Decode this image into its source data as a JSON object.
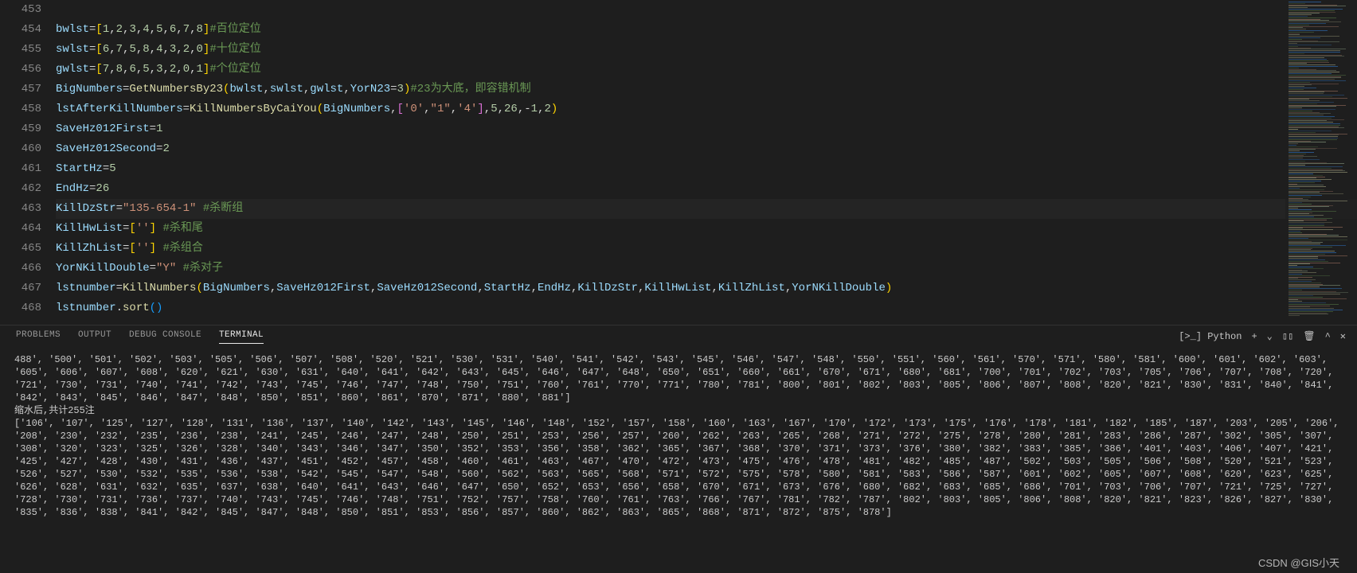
{
  "editor": {
    "lines": [
      {
        "num": 453,
        "tokens": []
      },
      {
        "num": 454,
        "tokens": [
          [
            "v",
            "bwlst"
          ],
          [
            "op",
            "="
          ],
          [
            "p",
            "["
          ],
          [
            "n",
            "1"
          ],
          [
            "op",
            ","
          ],
          [
            "n",
            "2"
          ],
          [
            "op",
            ","
          ],
          [
            "n",
            "3"
          ],
          [
            "op",
            ","
          ],
          [
            "n",
            "4"
          ],
          [
            "op",
            ","
          ],
          [
            "n",
            "5"
          ],
          [
            "op",
            ","
          ],
          [
            "n",
            "6"
          ],
          [
            "op",
            ","
          ],
          [
            "n",
            "7"
          ],
          [
            "op",
            ","
          ],
          [
            "n",
            "8"
          ],
          [
            "p",
            "]"
          ],
          [
            "c",
            "#百位定位"
          ]
        ]
      },
      {
        "num": 455,
        "tokens": [
          [
            "v",
            "swlst"
          ],
          [
            "op",
            "="
          ],
          [
            "p",
            "["
          ],
          [
            "n",
            "6"
          ],
          [
            "op",
            ","
          ],
          [
            "n",
            "7"
          ],
          [
            "op",
            ","
          ],
          [
            "n",
            "5"
          ],
          [
            "op",
            ","
          ],
          [
            "n",
            "8"
          ],
          [
            "op",
            ","
          ],
          [
            "n",
            "4"
          ],
          [
            "op",
            ","
          ],
          [
            "n",
            "3"
          ],
          [
            "op",
            ","
          ],
          [
            "n",
            "2"
          ],
          [
            "op",
            ","
          ],
          [
            "n",
            "0"
          ],
          [
            "p",
            "]"
          ],
          [
            "c",
            "#十位定位"
          ]
        ]
      },
      {
        "num": 456,
        "tokens": [
          [
            "v",
            "gwlst"
          ],
          [
            "op",
            "="
          ],
          [
            "p",
            "["
          ],
          [
            "n",
            "7"
          ],
          [
            "op",
            ","
          ],
          [
            "n",
            "8"
          ],
          [
            "op",
            ","
          ],
          [
            "n",
            "6"
          ],
          [
            "op",
            ","
          ],
          [
            "n",
            "5"
          ],
          [
            "op",
            ","
          ],
          [
            "n",
            "3"
          ],
          [
            "op",
            ","
          ],
          [
            "n",
            "2"
          ],
          [
            "op",
            ","
          ],
          [
            "n",
            "0"
          ],
          [
            "op",
            ","
          ],
          [
            "n",
            "1"
          ],
          [
            "p",
            "]"
          ],
          [
            "c",
            "#个位定位"
          ]
        ]
      },
      {
        "num": 457,
        "tokens": [
          [
            "v",
            "BigNumbers"
          ],
          [
            "op",
            "="
          ],
          [
            "f",
            "GetNumbersBy23"
          ],
          [
            "p",
            "("
          ],
          [
            "v",
            "bwlst"
          ],
          [
            "op",
            ","
          ],
          [
            "v",
            "swlst"
          ],
          [
            "op",
            ","
          ],
          [
            "v",
            "gwlst"
          ],
          [
            "op",
            ","
          ],
          [
            "v",
            "YorN23"
          ],
          [
            "op",
            "="
          ],
          [
            "n",
            "3"
          ],
          [
            "p",
            ")"
          ],
          [
            "c",
            "#23为大底，即容错机制"
          ]
        ]
      },
      {
        "num": 458,
        "tokens": [
          [
            "v",
            "lstAfterKillNumbers"
          ],
          [
            "op",
            "="
          ],
          [
            "f",
            "KillNumbersByCaiYou"
          ],
          [
            "p",
            "("
          ],
          [
            "v",
            "BigNumbers"
          ],
          [
            "op",
            ","
          ],
          [
            "p2",
            "["
          ],
          [
            "s",
            "'0'"
          ],
          [
            "op",
            ","
          ],
          [
            "s",
            "\"1\""
          ],
          [
            "op",
            ","
          ],
          [
            "s",
            "'4'"
          ],
          [
            "p2",
            "]"
          ],
          [
            "op",
            ","
          ],
          [
            "n",
            "5"
          ],
          [
            "op",
            ","
          ],
          [
            "n",
            "26"
          ],
          [
            "op",
            ",-"
          ],
          [
            "n",
            "1"
          ],
          [
            "op",
            ","
          ],
          [
            "n",
            "2"
          ],
          [
            "p",
            ")"
          ]
        ]
      },
      {
        "num": 459,
        "tokens": [
          [
            "v",
            "SaveHz012First"
          ],
          [
            "op",
            "="
          ],
          [
            "n",
            "1"
          ]
        ]
      },
      {
        "num": 460,
        "tokens": [
          [
            "v",
            "SaveHz012Second"
          ],
          [
            "op",
            "="
          ],
          [
            "n",
            "2"
          ]
        ]
      },
      {
        "num": 461,
        "tokens": [
          [
            "v",
            "StartHz"
          ],
          [
            "op",
            "="
          ],
          [
            "n",
            "5"
          ]
        ]
      },
      {
        "num": 462,
        "tokens": [
          [
            "v",
            "EndHz"
          ],
          [
            "op",
            "="
          ],
          [
            "n",
            "26"
          ]
        ]
      },
      {
        "num": 463,
        "hl": true,
        "tokens": [
          [
            "v",
            "KillDzStr"
          ],
          [
            "op",
            "="
          ],
          [
            "s",
            "\"135-654-1\""
          ],
          [
            "op",
            " "
          ],
          [
            "c",
            "#杀断组"
          ]
        ]
      },
      {
        "num": 464,
        "tokens": [
          [
            "v",
            "KillHwList"
          ],
          [
            "op",
            "="
          ],
          [
            "p",
            "["
          ],
          [
            "s",
            "''"
          ],
          [
            "p",
            "]"
          ],
          [
            "op",
            " "
          ],
          [
            "c",
            "#杀和尾"
          ]
        ]
      },
      {
        "num": 465,
        "tokens": [
          [
            "v",
            "KillZhList"
          ],
          [
            "op",
            "="
          ],
          [
            "p",
            "["
          ],
          [
            "s",
            "''"
          ],
          [
            "p",
            "]"
          ],
          [
            "op",
            " "
          ],
          [
            "c",
            "#杀组合"
          ]
        ]
      },
      {
        "num": 466,
        "tokens": [
          [
            "v",
            "YorNKillDouble"
          ],
          [
            "op",
            "="
          ],
          [
            "s",
            "\"Y\""
          ],
          [
            "op",
            " "
          ],
          [
            "c",
            "#杀对子"
          ]
        ]
      },
      {
        "num": 467,
        "tokens": [
          [
            "v",
            "lstnumber"
          ],
          [
            "op",
            "="
          ],
          [
            "f",
            "KillNumbers"
          ],
          [
            "p",
            "("
          ],
          [
            "v",
            "BigNumbers"
          ],
          [
            "op",
            ","
          ],
          [
            "v",
            "SaveHz012First"
          ],
          [
            "op",
            ","
          ],
          [
            "v",
            "SaveHz012Second"
          ],
          [
            "op",
            ","
          ],
          [
            "v",
            "StartHz"
          ],
          [
            "op",
            ","
          ],
          [
            "v",
            "EndHz"
          ],
          [
            "op",
            ","
          ],
          [
            "v",
            "KillDzStr"
          ],
          [
            "op",
            ","
          ],
          [
            "v",
            "KillHwList"
          ],
          [
            "op",
            ","
          ],
          [
            "v",
            "KillZhList"
          ],
          [
            "op",
            ","
          ],
          [
            "v",
            "YorNKillDouble"
          ],
          [
            "p",
            ")"
          ]
        ]
      },
      {
        "num": 468,
        "tokens": [
          [
            "v",
            "lstnumber"
          ],
          [
            "op",
            "."
          ],
          [
            "f",
            "sort"
          ],
          [
            "p3",
            "()"
          ]
        ]
      }
    ]
  },
  "panel": {
    "tabs": [
      "PROBLEMS",
      "OUTPUT",
      "DEBUG CONSOLE",
      "TERMINAL"
    ],
    "active_tab": 3,
    "launch_badge": "Python",
    "terminal_lines": [
      "488', '500', '501', '502', '503', '505', '506', '507', '508', '520', '521', '530', '531', '540', '541', '542', '543', '545', '546', '547', '548', '550', '551', '560', '561', '570', '571', '580', '581', '600', '601', '602', '603', '605', '606', '607', '608', '620', '621', '630', '631', '640', '641', '642', '643', '645', '646', '647', '648', '650', '651', '660', '661', '670', '671', '680', '681', '700', '701', '702', '703', '705', '706', '707', '708', '720', '721', '730', '731', '740', '741', '742', '743', '745', '746', '747', '748', '750', '751', '760', '761', '770', '771', '780', '781', '800', '801', '802', '803', '805', '806', '807', '808', '820', '821', '830', '831', '840', '841', '842', '843', '845', '846', '847', '848', '850', '851', '860', '861', '870', '871', '880', '881']",
      "缩水后,共计255注",
      "['106', '107', '125', '127', '128', '131', '136', '137', '140', '142', '143', '145', '146', '148', '152', '157', '158', '160', '163', '167', '170', '172', '173', '175', '176', '178', '181', '182', '185', '187', '203', '205', '206', '208', '230', '232', '235', '236', '238', '241', '245', '246', '247', '248', '250', '251', '253', '256', '257', '260', '262', '263', '265', '268', '271', '272', '275', '278', '280', '281', '283', '286', '287', '302', '305', '307', '308', '320', '323', '325', '326', '328', '340', '343', '346', '347', '350', '352', '353', '356', '358', '362', '365', '367', '368', '370', '371', '373', '376', '380', '382', '383', '385', '386', '401', '403', '406', '407', '421', '425', '427', '428', '430', '431', '436', '437', '451', '452', '457', '458', '460', '461', '463', '467', '470', '472', '473', '475', '476', '478', '481', '482', '485', '487', '502', '503', '505', '506', '508', '520', '521', '523', '526', '527', '530', '532', '535', '536', '538', '542', '545', '547', '548', '560', '562', '563', '565', '568', '571', '572', '575', '578', '580', '581', '583', '586', '587', '601', '602', '605', '607', '608', '620', '623', '625', '626', '628', '631', '632', '635', '637', '638', '640', '641', '643', '646', '647', '650', '652', '653', '656', '658', '670', '671', '673', '676', '680', '682', '683', '685', '686', '701', '703', '706', '707', '721', '725', '727', '728', '730', '731', '736', '737', '740', '743', '745', '746', '748', '751', '752', '757', '758', '760', '761', '763', '766', '767', '781', '782', '787', '802', '803', '805', '806', '808', '820', '821', '823', '826', '827', '830', '835', '836', '838', '841', '842', '845', '847', '848', '850', '851', '853', '856', '857', '860', '862', '863', '865', '868', '871', '872', '875', '878']"
    ]
  },
  "watermark": "CSDN @GIS小天"
}
